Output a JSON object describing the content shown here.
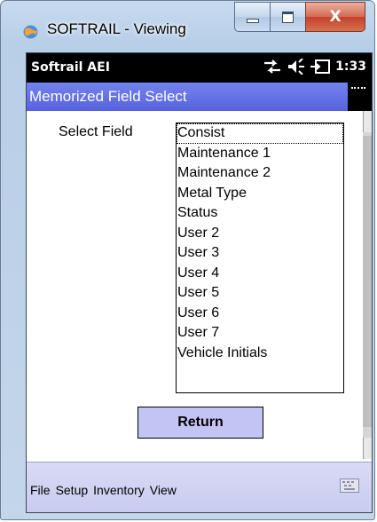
{
  "window": {
    "title": "SOFTRAIL - Viewing",
    "icons": [
      "app-globe-icon",
      "minimize-icon",
      "maximize-icon",
      "close-icon"
    ],
    "close_glyph": "X"
  },
  "statusbar": {
    "app_name": "Softrail AEI",
    "time": "1:33",
    "icons": [
      "connectivity-arrows-icon",
      "speaker-icon",
      "battery-plug-icon"
    ]
  },
  "header": {
    "title": "Memorized Field Select"
  },
  "form": {
    "field_label": "Select Field",
    "options": [
      "Consist",
      "Maintenance 1",
      "Maintenance 2",
      "Metal Type",
      "Status",
      "User 2",
      "User 3",
      "User 4",
      "User 5",
      "User 6",
      "User 7",
      "Vehicle Initials"
    ],
    "selected_index": 0,
    "return_label": "Return"
  },
  "menubar": {
    "items": [
      "File",
      "Setup",
      "Inventory",
      "View"
    ],
    "keyboard_icon": "keyboard-icon"
  },
  "colors": {
    "header_bg": "#5e6ae3",
    "menubar_bg": "#cfd1f2",
    "button_bg": "#c4c4f4",
    "close_button": "#c9472e"
  }
}
